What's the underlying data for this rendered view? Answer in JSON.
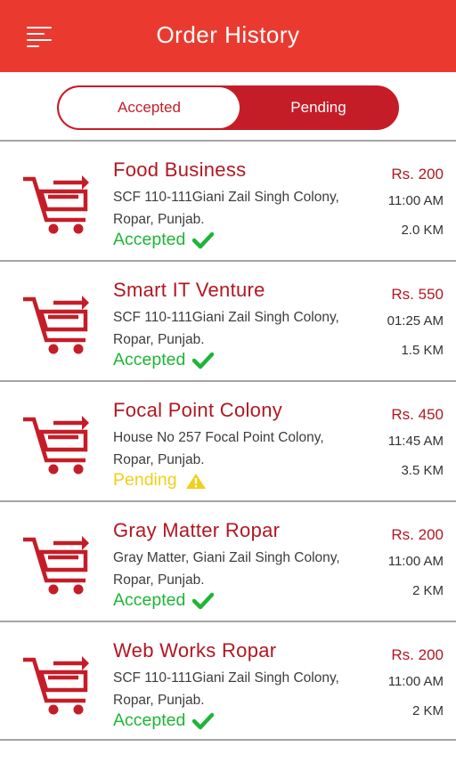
{
  "header": {
    "title": "Order History",
    "menu_icon": "hamburger-menu-icon"
  },
  "tabs": {
    "accepted_label": "Accepted",
    "pending_label": "Pending",
    "active": "Accepted"
  },
  "colors": {
    "header": "#ea3a2f",
    "accent": "#c51d28",
    "accepted": "#1fb537",
    "pending": "#f2cf1a"
  },
  "orders": [
    {
      "name": "Food Business",
      "address_line1": "SCF 110-111Giani Zail Singh Colony,",
      "address_line2": "Ropar, Punjab.",
      "status": "Accepted",
      "price": "Rs. 200",
      "time": "11:00 AM",
      "distance": "2.0 KM"
    },
    {
      "name": "Smart IT Venture",
      "address_line1": "SCF 110-111Giani Zail Singh Colony,",
      "address_line2": "Ropar, Punjab.",
      "status": "Accepted",
      "price": "Rs. 550",
      "time": "01:25 AM",
      "distance": "1.5 KM"
    },
    {
      "name": "Focal Point Colony",
      "address_line1": "House No 257 Focal Point Colony,",
      "address_line2": "Ropar, Punjab.",
      "status": "Pending",
      "price": "Rs. 450",
      "time": "11:45 AM",
      "distance": "3.5 KM"
    },
    {
      "name": "Gray Matter Ropar",
      "address_line1": "Gray Matter, Giani Zail Singh Colony,",
      "address_line2": "Ropar, Punjab.",
      "status": "Accepted",
      "price": "Rs. 200",
      "time": "11:00 AM",
      "distance": "2 KM"
    },
    {
      "name": "Web Works Ropar",
      "address_line1": "SCF 110-111Giani Zail Singh Colony,",
      "address_line2": "Ropar, Punjab.",
      "status": "Accepted",
      "price": "Rs. 200",
      "time": "11:00 AM",
      "distance": "2 KM"
    }
  ]
}
